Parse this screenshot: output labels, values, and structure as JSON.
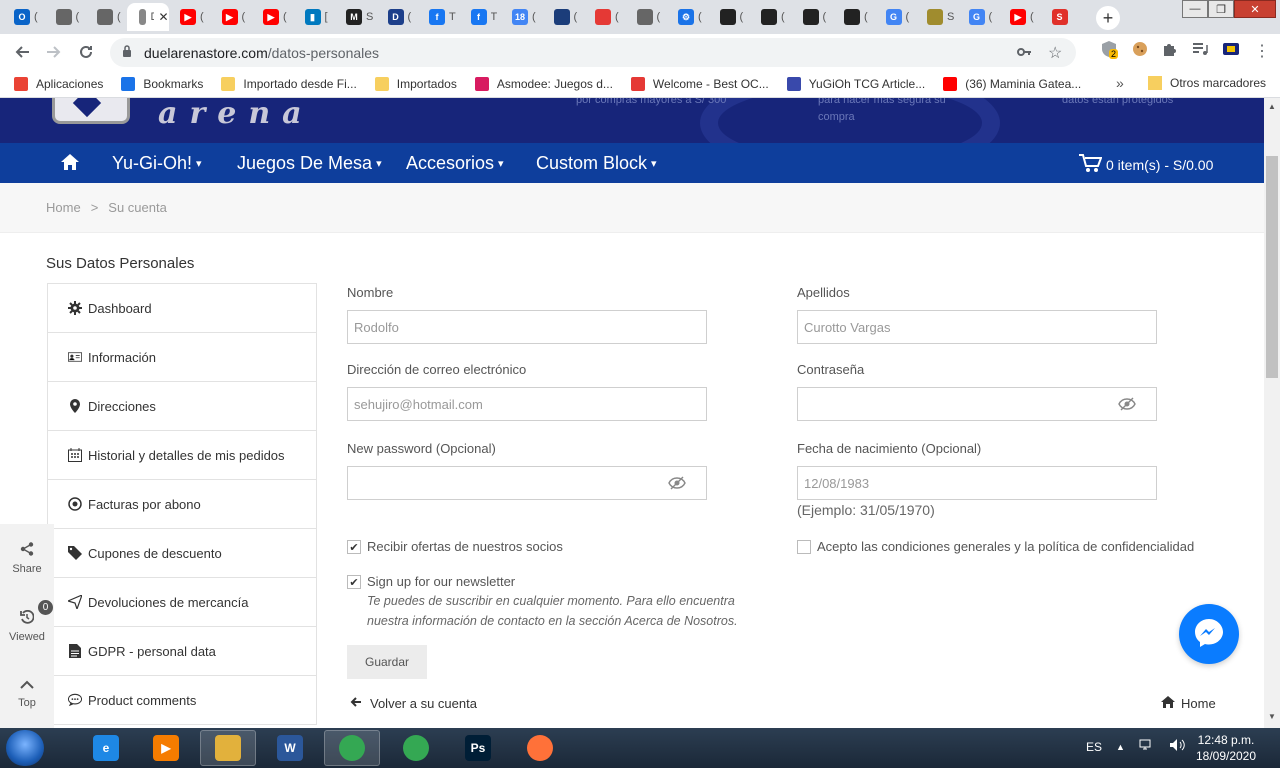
{
  "browser": {
    "tabs": [
      {
        "icon": "outlook-icon",
        "color": "#0a64c8",
        "letter": "O",
        "title": "("
      },
      {
        "icon": "site-icon",
        "color": "#666666",
        "letter": "",
        "title": "("
      },
      {
        "icon": "site-icon",
        "color": "#666666",
        "letter": "",
        "title": "("
      },
      {
        "icon": "duel-icon",
        "color": "#888888",
        "letter": "",
        "title": "D",
        "active": true
      },
      {
        "icon": "youtube-icon",
        "color": "#ff0000",
        "letter": "▶",
        "title": "("
      },
      {
        "icon": "youtube-icon",
        "color": "#ff0000",
        "letter": "▶",
        "title": "("
      },
      {
        "icon": "youtube-icon",
        "color": "#ff0000",
        "letter": "▶",
        "title": "("
      },
      {
        "icon": "trello-icon",
        "color": "#0079bf",
        "letter": "▮",
        "title": "["
      },
      {
        "icon": "site-icon",
        "color": "#222222",
        "letter": "M",
        "title": "S"
      },
      {
        "icon": "devir-icon",
        "color": "#1d3f8a",
        "letter": "D",
        "title": "("
      },
      {
        "icon": "facebook-icon",
        "color": "#1877f2",
        "letter": "f",
        "title": "T"
      },
      {
        "icon": "facebook-icon",
        "color": "#1877f2",
        "letter": "f",
        "title": "T"
      },
      {
        "icon": "calendar-icon",
        "color": "#4285f4",
        "letter": "18",
        "title": "("
      },
      {
        "icon": "site-icon",
        "color": "#1b3d7a",
        "letter": "",
        "title": "("
      },
      {
        "icon": "site-icon",
        "color": "#e53935",
        "letter": "",
        "title": "("
      },
      {
        "icon": "globe-icon",
        "color": "#666666",
        "letter": "",
        "title": "("
      },
      {
        "icon": "gear-icon",
        "color": "#1a73e8",
        "letter": "⚙",
        "title": "("
      },
      {
        "icon": "site-icon",
        "color": "#222222",
        "letter": "",
        "title": "("
      },
      {
        "icon": "site-icon",
        "color": "#222222",
        "letter": "",
        "title": "("
      },
      {
        "icon": "site-icon",
        "color": "#222222",
        "letter": "",
        "title": "("
      },
      {
        "icon": "site-icon",
        "color": "#222222",
        "letter": "",
        "title": "("
      },
      {
        "icon": "google-icon",
        "color": "#4285f4",
        "letter": "G",
        "title": "("
      },
      {
        "icon": "site-icon",
        "color": "#a08c2e",
        "letter": "",
        "title": "S"
      },
      {
        "icon": "google-icon",
        "color": "#4285f4",
        "letter": "G",
        "title": "("
      },
      {
        "icon": "youtube-icon",
        "color": "#ff0000",
        "letter": "▶",
        "title": "("
      },
      {
        "icon": "site-icon",
        "color": "#e0302a",
        "letter": "S",
        "title": ""
      }
    ],
    "active_tab_close": "✕",
    "new_tab": "+",
    "url_domain": "duelarenastore.com",
    "url_path": "/datos-personales",
    "bookmarks": [
      {
        "label": "Aplicaciones",
        "color": "#ea4335"
      },
      {
        "label": "Bookmarks",
        "color": "#1a73e8"
      },
      {
        "label": "Importado desde Fi...",
        "color": "#f7cf5f"
      },
      {
        "label": "Importados",
        "color": "#f7cf5f"
      },
      {
        "label": "Asmodee: Juegos d...",
        "color": "#d81b60"
      },
      {
        "label": "Welcome - Best OC...",
        "color": "#e53935"
      },
      {
        "label": "YuGiOh TCG Article...",
        "color": "#3949ab"
      },
      {
        "label": "(36) Maminia Gatea...",
        "color": "#ff0000"
      }
    ],
    "bookmarks_more": "»",
    "other_bookmarks": "Otros marcadores",
    "ext_badge": "2"
  },
  "site": {
    "logo_text": "arena",
    "header_texts": [
      "por compras mayores a S/ 300",
      "para hacer más segura su compra",
      "datos están protegidos"
    ],
    "menu": [
      {
        "label": "Yu-Gi-Oh!"
      },
      {
        "label": "Juegos De Mesa"
      },
      {
        "label": "Accesorios"
      },
      {
        "label": "Custom Block"
      }
    ],
    "cart": "0 item(s) - S/0.00",
    "breadcrumb": {
      "home": "Home",
      "sep": ">",
      "current": "Su cuenta"
    }
  },
  "page": {
    "title": "Sus Datos Personales",
    "account_menu": [
      {
        "icon": "gear-icon",
        "label": "Dashboard"
      },
      {
        "icon": "id-card-icon",
        "label": "Información"
      },
      {
        "icon": "map-pin-icon",
        "label": "Direcciones"
      },
      {
        "icon": "calendar-icon",
        "label": "Historial y detalles de mis pedidos"
      },
      {
        "icon": "target-icon",
        "label": "Facturas por abono"
      },
      {
        "icon": "tag-icon",
        "label": "Cupones de descuento"
      },
      {
        "icon": "send-icon",
        "label": "Devoluciones de mercancía"
      },
      {
        "icon": "document-icon",
        "label": "GDPR - personal data"
      },
      {
        "icon": "comment-icon",
        "label": "Product comments"
      }
    ],
    "side_widget": {
      "share": "Share",
      "viewed": "Viewed",
      "viewed_count": "0",
      "top": "Top"
    },
    "form": {
      "nombre_label": "Nombre",
      "nombre_value": "Rodolfo",
      "apellidos_label": "Apellidos",
      "apellidos_value": "Curotto Vargas",
      "email_label": "Dirección de correo electrónico",
      "email_value": "sehujiro@hotmail.com",
      "password_label": "Contraseña",
      "password_value": "",
      "new_password_label": "New password (Opcional)",
      "new_password_value": "",
      "birth_label": "Fecha de nacimiento (Opcional)",
      "birth_value": "12/08/1983",
      "birth_hint": "(Ejemplo: 31/05/1970)",
      "partners_label": "Recibir ofertas de nuestros socios",
      "partners_checked": true,
      "terms_label": "Acepto las condiciones generales y la política de confidencialidad",
      "terms_checked": false,
      "newsletter_label": "Sign up for our newsletter",
      "newsletter_checked": true,
      "newsletter_note": "Te puedes de suscribir en cualquier momento. Para ello encuentra nuestra información de contacto en la sección Acerca de Nosotros.",
      "save_button": "Guardar"
    },
    "back_link": "Volver a su cuenta",
    "home_link": "Home"
  },
  "taskbar": {
    "apps": [
      {
        "icon": "internet-explorer-icon",
        "color": "#1e88e5",
        "letter": "e"
      },
      {
        "icon": "media-player-icon",
        "color": "#f57c00",
        "letter": "▶"
      },
      {
        "icon": "file-explorer-icon",
        "color": "#e2b13c",
        "letter": ""
      },
      {
        "icon": "word-icon",
        "color": "#2b579a",
        "letter": "W"
      },
      {
        "icon": "chrome-icon",
        "color": "#34a853",
        "letter": ""
      },
      {
        "icon": "chrome-icon",
        "color": "#34a853",
        "letter": ""
      },
      {
        "icon": "photoshop-icon",
        "color": "#001e36",
        "letter": "Ps"
      },
      {
        "icon": "firefox-icon",
        "color": "#ff7139",
        "letter": ""
      }
    ],
    "language": "ES",
    "time": "12:48 p.m.",
    "date": "18/09/2020"
  }
}
